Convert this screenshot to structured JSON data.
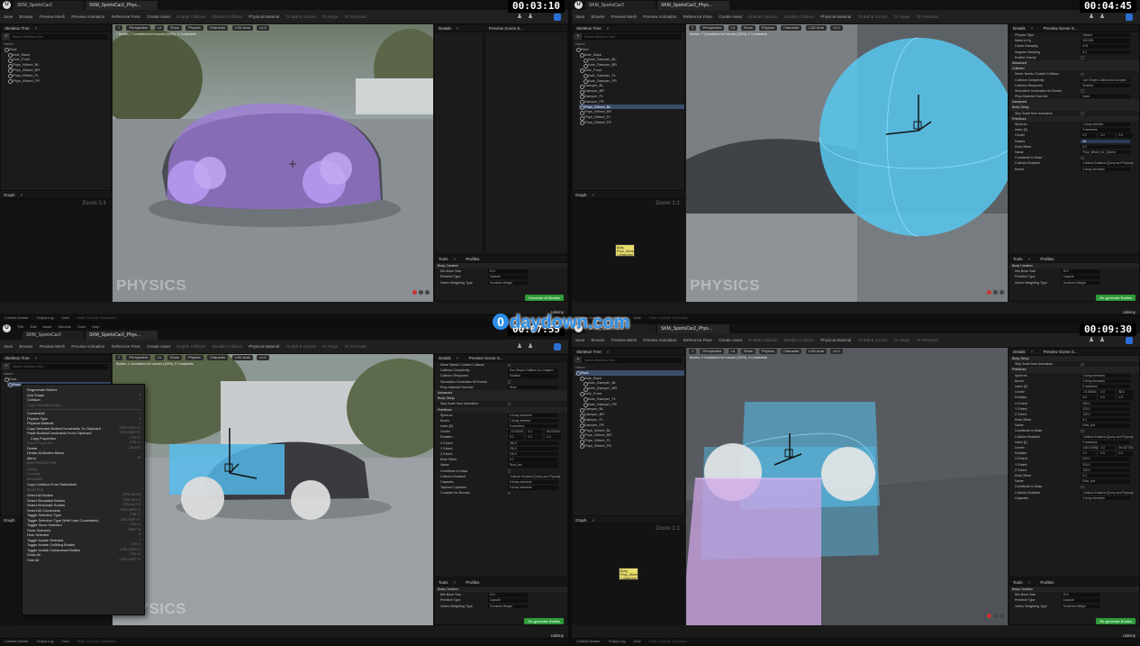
{
  "watermark": {
    "site": "daydown.com",
    "icon": "0"
  },
  "common": {
    "toolbar": [
      "Save",
      "Browse",
      "Preview Mesh",
      "Preview Animation",
      "Reference Pose",
      "Create Asset",
      "Enable Collision",
      "Disable Collision",
      "Physical Material",
      "To Ball & Socket",
      "To Hinge",
      "To Prismatic"
    ],
    "skeleton_tree_title": "Skeleton Tree",
    "search_placeholder": "Search Skeleton Tree...",
    "name_header": "Name",
    "graph_title": "Graph",
    "zoom_label": "Zoom 1:1",
    "details_title": "Details",
    "preview_title": "Preview Scene S...",
    "tools_title": "Tools",
    "profiles_title": "Profiles",
    "physics_watermark": "PHYSICS",
    "viewport_buttons": [
      "Perspective",
      "Lit",
      "Show",
      "Physics",
      "Character",
      "LOD Auto",
      "x1.0"
    ],
    "status": [
      "Content Drawer",
      "Output Log",
      "Cmd"
    ],
    "status_input": "Enter Console Command",
    "udemy": "Udemy",
    "source_control": "Source Control Off",
    "node_label": "Body\nPhys_Wheel_BL\n1 shapes(s)",
    "tools_rows": [
      {
        "label": "Body Creation",
        "sec": true
      },
      {
        "label": "Min Bone Size",
        "value": "20.0"
      },
      {
        "label": "Primitive Type",
        "value": "Capsule"
      },
      {
        "label": "Vertex Weighting Type",
        "value": "Dominant Weight"
      }
    ]
  },
  "q1": {
    "timestamp": "00:03:10",
    "tabs": [
      "SKM_SportsCar2",
      "SKM_SportsCar2_Phys..."
    ],
    "vp_info": "7 Bodies, 7 Considered for bounds (100%), 0 Constraints",
    "tree": [
      "Root",
      "Axle_Back",
      "Axle_Front",
      "Phys_Wheel_BL",
      "Phys_Wheel_BR",
      "Phys_Wheel_FL",
      "Phys_Wheel_FR"
    ],
    "gen_button": "Generate All Bodies"
  },
  "q2": {
    "timestamp": "00:04:45",
    "tabs": [
      "SKM_SportsCar2",
      "SKM_SportsCar2_Phys..."
    ],
    "vp_info": "Bodies, 7 Considered for bounds (100%), 0 Constraints",
    "tree": [
      "Root",
      "Axle_Back",
      "Axle_Damper_BL",
      "Axle_Damper_BR",
      "Axle_Front",
      "Axle_Damper_FL",
      "Axle_Damper_FR",
      "Damper_BL",
      "Damper_BR",
      "Damper_FL",
      "Damper_FR",
      "Phys_Wheel_BL",
      "Phys_Wheel_BR",
      "Phys_Wheel_FL",
      "Phys_Wheel_FR"
    ],
    "selected": 11,
    "details": [
      {
        "label": "Physics Type",
        "value": "Default"
      },
      {
        "label": "Mass in Kg",
        "value": "100.000"
      },
      {
        "label": "Linear Damping",
        "value": "0.01"
      },
      {
        "label": "Angular Damping",
        "value": "0.0"
      },
      {
        "label": "Enable Gravity",
        "check": true
      },
      {
        "label": "Advanced",
        "sec": true
      },
      {
        "label": "Collision",
        "sec": true
      },
      {
        "label": "Never Needs Cooked Collision",
        "check": true
      },
      {
        "label": "Collision Complexity",
        "value": "Use Simple Collision As Complex"
      },
      {
        "label": "Collision Response",
        "value": "Enabled"
      },
      {
        "label": "Simulation Generates Hit Events",
        "check": true
      },
      {
        "label": "Phys Material Override",
        "value": "None"
      },
      {
        "label": "Advanced",
        "sec": true
      },
      {
        "label": "Body Setup",
        "sec": true
      },
      {
        "label": "Skip Scale from Animation",
        "check": true
      },
      {
        "label": "Primitives",
        "sec": true
      },
      {
        "label": "Spheres",
        "value": "1 Array element"
      },
      {
        "label": "Index [0]",
        "value": "9 members"
      },
      {
        "label": "Center",
        "v1": "0.0",
        "v2": "0.0",
        "v3": "0.0"
      },
      {
        "label": "Radius",
        "value": "26",
        "hl": true
      },
      {
        "label": "Rest Offset",
        "value": "0.0"
      },
      {
        "label": "Name",
        "value": "Phys_Wheel_BL_Sphere"
      },
      {
        "label": "Contribute to Mass",
        "check": true
      },
      {
        "label": "Collision Enabled",
        "value": "Collision Enabled (Query and Physics)"
      },
      {
        "label": "Boxes",
        "value": "0 Array elements"
      }
    ],
    "gen_button": "Re-generate Bodies"
  },
  "q3": {
    "timestamp": "00:07:55",
    "tabs": [
      "SKM_SportsCar2",
      "SKM_SportsCar2_Phys..."
    ],
    "menus": [
      "File",
      "Edit",
      "Asset",
      "Window",
      "Tools",
      "Help"
    ],
    "vp_info": "Bodies, 1 Considered for bounds (100%), 0 Constraints",
    "context_menu": [
      {
        "label": "Regenerate Bodies"
      },
      {
        "label": "Add Shape",
        "arrow": true
      },
      {
        "label": "Collision",
        "arrow": true
      },
      {
        "label": "Copy Selected Bodies",
        "dis": true
      },
      {
        "sep": true
      },
      {
        "label": "Constraints",
        "arrow": true
      },
      {
        "label": "Physics Type",
        "arrow": true
      },
      {
        "label": "Physical Material",
        "arrow": true
      },
      {
        "label": "Copy Selected Bodies/Constraints To Clipboard",
        "key": "CTRL+SHIFT+C"
      },
      {
        "label": "Paste Bodies/Constraints From Clipboard",
        "key": "CTRL+SHIFT+V"
      },
      {
        "label": "Copy Properties",
        "key": "CTRL+C",
        "sub": true
      },
      {
        "label": "Paste Properties",
        "dis": true,
        "key": "CTRL+V"
      },
      {
        "label": "Delete",
        "key": "DELETE"
      },
      {
        "label": "Delete All Bodies Below"
      },
      {
        "label": "Mirror",
        "key": "M"
      },
      {
        "header": "BODY PHYSICS TYPE"
      },
      {
        "label": "Assign",
        "dis": true
      },
      {
        "label": "Unweigh",
        "dis": true
      },
      {
        "header": "ADVANCED"
      },
      {
        "label": "Copy Collision From StaticMesh"
      },
      {
        "header": "SELECTION"
      },
      {
        "label": "Select All Bodies",
        "key": "CTRL+ALT+A"
      },
      {
        "label": "Select Simulated Bodies",
        "key": "CTRL+ALT+S"
      },
      {
        "label": "Select Kinematic Bodies",
        "key": "CTRL+ALT+K"
      },
      {
        "label": "Select All Constraints",
        "key": "CTRL+SHIFT+A"
      },
      {
        "label": "Toggle Selection Type",
        "key": "CTRL+T"
      },
      {
        "label": "Toggle Selection Type (With User Constraints)",
        "key": "CTRL+SHIFT+T"
      },
      {
        "label": "Toggle Show Selected",
        "key": "CTRL+H"
      },
      {
        "label": "Show Selected",
        "key": "SHIFT+H"
      },
      {
        "label": "Hide Selected",
        "key": "H"
      },
      {
        "label": "Toggle Isolate Selected",
        "key": "I"
      },
      {
        "label": "Toggle Isolate Colliding Bodies",
        "key": "CTRL+I"
      },
      {
        "label": "Toggle Isolate Constrained Bodies",
        "key": "CTRL+SHIFT+I"
      },
      {
        "label": "Show All",
        "key": "CTRL+H"
      },
      {
        "label": "Hide All",
        "key": "CTRL+SHIFT+H"
      }
    ],
    "details": [
      {
        "label": "Never Needs Cooked Collision",
        "check": true
      },
      {
        "label": "Collision Complexity",
        "value": "Use Simple Collision As Complex"
      },
      {
        "label": "Collision Response",
        "value": "Enabled"
      },
      {
        "label": "Simulation Generates Hit Events",
        "check": true
      },
      {
        "label": "Phys Material Override",
        "value": "None"
      },
      {
        "label": "Advanced",
        "sec": true
      },
      {
        "label": "Body Setup",
        "sec": true
      },
      {
        "label": "Skip Scale from Animation",
        "check": true
      },
      {
        "label": "Primitives",
        "sec": true
      },
      {
        "label": "Spheres",
        "value": "0 Array elements"
      },
      {
        "label": "Boxes",
        "value": "1 Array element"
      },
      {
        "label": "Index [0]",
        "value": "9 members"
      },
      {
        "label": "Center",
        "v1": "-72.05200",
        "v2": "0.0",
        "v3": "66.222947"
      },
      {
        "label": "Rotation",
        "v1": "0.0",
        "v2": "0.0",
        "v3": "0.0"
      },
      {
        "label": "X Extent",
        "value": "280.0"
      },
      {
        "label": "Y Extent",
        "value": "230.0"
      },
      {
        "label": "Z Extent",
        "value": "130.0"
      },
      {
        "label": "Rest Offset",
        "value": "0.0"
      },
      {
        "label": "Name",
        "value": "Root_box"
      },
      {
        "label": "Contribute to Mass",
        "check": true
      },
      {
        "label": "Collision Enabled",
        "value": "Collision Enabled (Query and Physics)"
      },
      {
        "label": "Capsules",
        "value": "0 Array elements"
      },
      {
        "label": "Tapered Capsules",
        "value": "0 Array elements"
      },
      {
        "label": "Consider for Bounds",
        "check": true
      }
    ],
    "gen_button": "Re-generate Bodies"
  },
  "q4": {
    "timestamp": "00:09:30",
    "tabs": [
      "SKM_SportsCar2",
      "SKM_SportsCar2_Phys..."
    ],
    "vp_info": "Bodies, 2 Considered for bounds (100%), 0 Constraints",
    "tree": [
      "Root",
      "Axle_Back",
      "Axle_Damper_BL",
      "Axle_Damper_BR",
      "Axle_Front",
      "Axle_Damper_FL",
      "Axle_Damper_FR",
      "Damper_BL",
      "Damper_BR",
      "Damper_FL",
      "Damper_FR",
      "Phys_Wheel_BL",
      "Phys_Wheel_BR",
      "Phys_Wheel_FL",
      "Phys_Wheel_FR"
    ],
    "selected": 0,
    "details": [
      {
        "label": "Body Setup",
        "sec": true
      },
      {
        "label": "Skip Scale from Animation",
        "check": true
      },
      {
        "label": "Primitives",
        "sec": true
      },
      {
        "label": "Spheres",
        "value": "0 Array elements"
      },
      {
        "label": "Boxes",
        "value": "2 Array elements"
      },
      {
        "label": "Index [0]",
        "value": "9 members"
      },
      {
        "label": "Center",
        "v1": "-72.05200",
        "v2": "0.0",
        "v3": "88.0"
      },
      {
        "label": "Rotation",
        "v1": "0.0",
        "v2": "0.0",
        "v3": "0.0"
      },
      {
        "label": "X Extent",
        "value": "280.0"
      },
      {
        "label": "Y Extent",
        "value": "220.0"
      },
      {
        "label": "Z Extent",
        "value": "130.0"
      },
      {
        "label": "Rest Offset",
        "value": "0.0"
      },
      {
        "label": "Name",
        "value": "Root_box"
      },
      {
        "label": "Contribute to Mass",
        "check": true
      },
      {
        "label": "Collision Enabled",
        "value": "Collision Enabled (Query and Physics)"
      },
      {
        "label": "Index [1]",
        "value": "9 members"
      },
      {
        "label": "Center",
        "v1": "136.074562",
        "v2": "0.0",
        "v3": "90.027738"
      },
      {
        "label": "Rotation",
        "v1": "0.0",
        "v2": "0.0",
        "v3": "0.0"
      },
      {
        "label": "X Extent",
        "value": "220.0"
      },
      {
        "label": "Y Extent",
        "value": "220.0"
      },
      {
        "label": "Z Extent",
        "value": "130.0"
      },
      {
        "label": "Rest Offset",
        "value": "0.0"
      },
      {
        "label": "Name",
        "value": "Root_box"
      },
      {
        "label": "Contribute to Mass",
        "check": true
      },
      {
        "label": "Collision Enabled",
        "value": "Collision Enabled (Query and Physics)"
      },
      {
        "label": "Capsules",
        "value": "0 Array elements"
      }
    ],
    "gen_button": "Re-generate Bodies"
  }
}
